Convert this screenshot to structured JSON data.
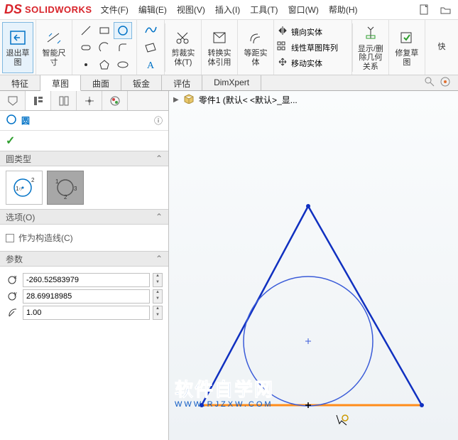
{
  "app": {
    "logo_text": "SOLIDWORKS"
  },
  "menu": {
    "file": "文件(F)",
    "edit": "编辑(E)",
    "view": "视图(V)",
    "insert": "插入(I)",
    "tools": "工具(T)",
    "window": "窗口(W)",
    "help": "帮助(H)"
  },
  "ribbon": {
    "exit_sketch": "退出草图",
    "smart_dim": "智能尺寸",
    "trim": "剪裁实体(T)",
    "convert": "转换实体引用",
    "offset": "等距实体",
    "mirror": "镜向实体",
    "pattern": "线性草图阵列",
    "move": "移动实体",
    "relations": "显示/删除几何关系",
    "repair": "修复草图",
    "quick": "快"
  },
  "tabs": {
    "feature": "特征",
    "sketch": "草图",
    "surface": "曲面",
    "sheet": "钣金",
    "eval": "评估",
    "dimxpert": "DimXpert"
  },
  "tree": {
    "part_name": "零件1  (默认< <默认>_显..."
  },
  "pm": {
    "title": "圆",
    "sec_type": "圆类型",
    "sec_opts": "选项(O)",
    "opt_construction": "作为构造线(C)",
    "sec_params": "参数",
    "cx": "-260.52583979",
    "cy": "28.69918985",
    "r": "1.00"
  },
  "watermark": {
    "line1": "软件自学网",
    "line2": "WWW.RJZXW.COM"
  }
}
